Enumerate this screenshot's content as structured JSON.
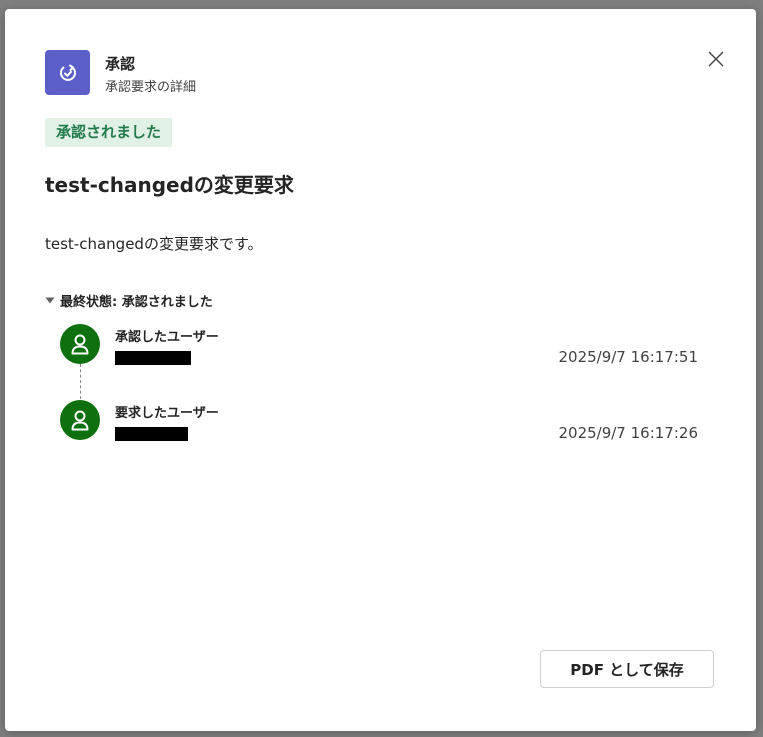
{
  "dialog": {
    "app_name": "承認",
    "app_subtitle": "承認要求の詳細",
    "status_badge": "承認されました",
    "title": "test-changedの変更要求",
    "description": "test-changedの変更要求です。",
    "final_status_label": "最終状態: 承認されました",
    "timeline": [
      {
        "label": "承認したユーザー",
        "timestamp": "2025/9/7 16:17:51"
      },
      {
        "label": "要求したユーザー",
        "timestamp": "2025/9/7 16:17:26"
      }
    ],
    "pdf_button": "PDF として保存"
  },
  "colors": {
    "accent": "#5b5fc7",
    "status_bg": "#e1f1e6",
    "status_text": "#237b4b",
    "avatar": "#0e700e"
  }
}
